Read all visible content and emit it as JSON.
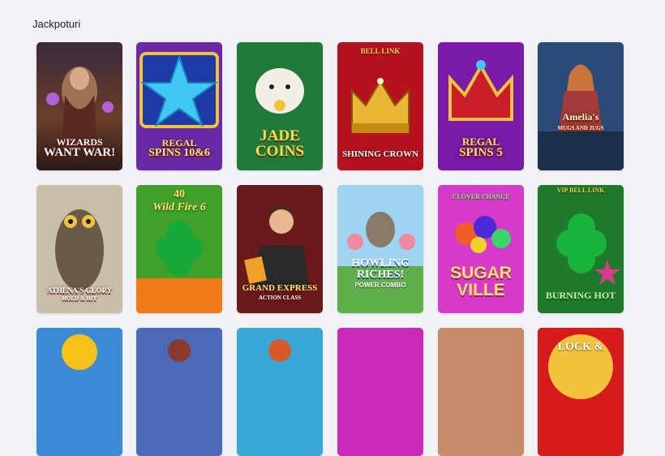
{
  "section": {
    "title": "Jackpoturi"
  },
  "games": [
    {
      "title_line1": "WIZARDS",
      "title_line2": "WANT WAR!",
      "subtitle": ""
    },
    {
      "title_line1": "REGAL",
      "title_line2": "SPINS 10&6",
      "subtitle": ""
    },
    {
      "title_line1": "JADE",
      "title_line2": "COINS",
      "subtitle": ""
    },
    {
      "title_line1": "SHINING CROWN",
      "title_line2": "",
      "subtitle": "",
      "badge": "BELL LINK"
    },
    {
      "title_line1": "REGAL",
      "title_line2": "SPINS 5",
      "subtitle": ""
    },
    {
      "title_line1": "Amelia's",
      "title_line2": "MUGS AND JUGS",
      "subtitle": ""
    },
    {
      "title_line1": "ATHENA'S GLORY",
      "title_line2": "HOLD & HIT",
      "subtitle": ""
    },
    {
      "title_line1": "40",
      "title_line2": "Wild Fire 6",
      "subtitle": ""
    },
    {
      "title_line1": "GRAND EXPRESS",
      "title_line2": "ACTION CLASS",
      "subtitle": ""
    },
    {
      "title_line1": "HOWLING",
      "title_line2": "RICHES!",
      "subtitle": "POWER COMBO"
    },
    {
      "title_line1": "SUGAR",
      "title_line2": "VILLE",
      "subtitle": "",
      "badge": "CLOVER CHANCE"
    },
    {
      "title_line1": "BURNING HOT",
      "title_line2": "",
      "subtitle": "",
      "badge": "VIP BELL LINK"
    },
    {
      "title_line1": "",
      "title_line2": "",
      "subtitle": ""
    },
    {
      "title_line1": "",
      "title_line2": "",
      "subtitle": ""
    },
    {
      "title_line1": "",
      "title_line2": "",
      "subtitle": ""
    },
    {
      "title_line1": "",
      "title_line2": "",
      "subtitle": ""
    },
    {
      "title_line1": "",
      "title_line2": "",
      "subtitle": ""
    },
    {
      "title_line1": "LOCK &",
      "title_line2": "",
      "subtitle": ""
    }
  ]
}
